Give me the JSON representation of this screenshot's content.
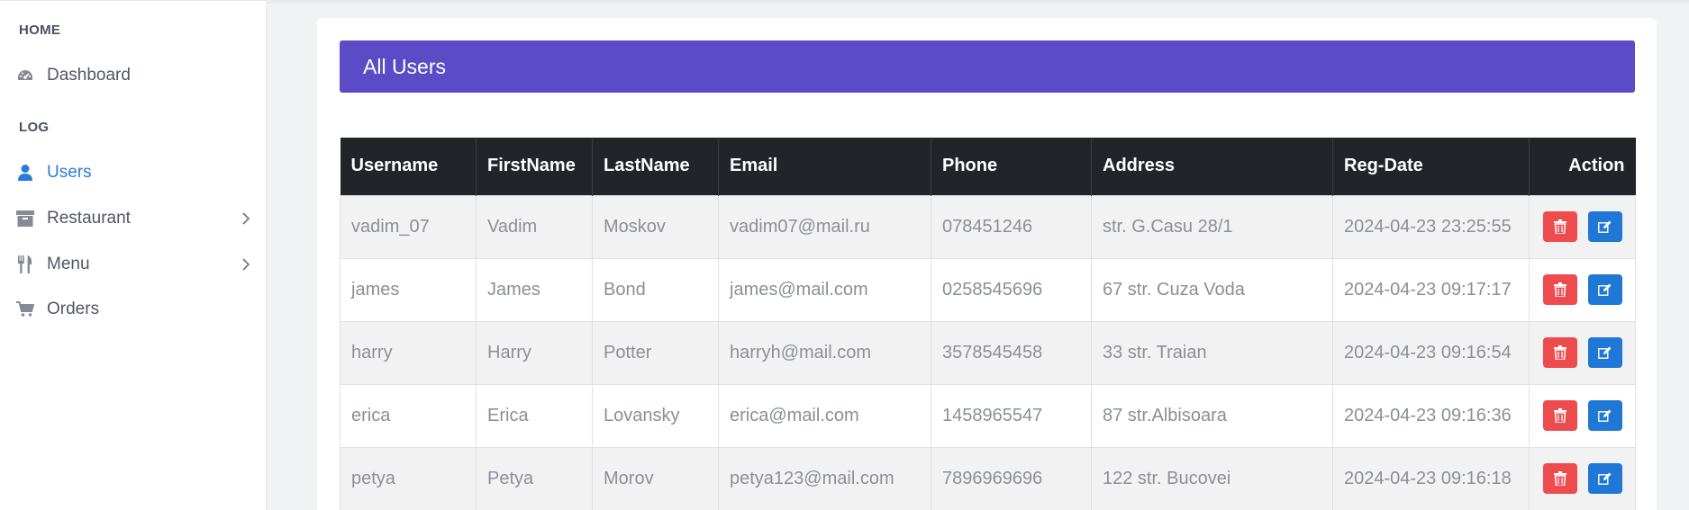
{
  "sidebar": {
    "sections": [
      {
        "header": "HOME"
      },
      {
        "header": "LOG"
      }
    ],
    "items": [
      {
        "label": "Dashboard",
        "icon": "dashboard-icon"
      },
      {
        "label": "Users",
        "icon": "user-icon",
        "active": true
      },
      {
        "label": "Restaurant",
        "icon": "archive-icon",
        "has_submenu": true
      },
      {
        "label": "Menu",
        "icon": "utensils-icon",
        "has_submenu": true
      },
      {
        "label": "Orders",
        "icon": "cart-icon"
      }
    ]
  },
  "card": {
    "title": "All Users"
  },
  "table": {
    "columns": [
      "Username",
      "FirstName",
      "LastName",
      "Email",
      "Phone",
      "Address",
      "Reg-Date",
      "Action"
    ],
    "rows": [
      {
        "username": "vadim_07",
        "firstname": "Vadim",
        "lastname": "Moskov",
        "email": "vadim07@mail.ru",
        "phone": "078451246",
        "address": "str. G.Casu 28/1",
        "reg_date": "2024-04-23 23:25:55"
      },
      {
        "username": "james",
        "firstname": "James",
        "lastname": "Bond",
        "email": "james@mail.com",
        "phone": "0258545696",
        "address": "67 str. Cuza Voda",
        "reg_date": "2024-04-23 09:17:17"
      },
      {
        "username": "harry",
        "firstname": "Harry",
        "lastname": "Potter",
        "email": "harryh@mail.com",
        "phone": "3578545458",
        "address": "33 str. Traian",
        "reg_date": "2024-04-23 09:16:54"
      },
      {
        "username": "erica",
        "firstname": "Erica",
        "lastname": "Lovansky",
        "email": "erica@mail.com",
        "phone": "1458965547",
        "address": "87 str.Albisoara",
        "reg_date": "2024-04-23 09:16:36"
      },
      {
        "username": "petya",
        "firstname": "Petya",
        "lastname": "Morov",
        "email": "petya123@mail.com",
        "phone": "7896969696",
        "address": "122 str. Bucovei",
        "reg_date": "2024-04-23 09:16:18"
      }
    ]
  },
  "colors": {
    "header_accent": "#5b4bc6",
    "table_head": "#212529",
    "delete_button": "#ee4b4f",
    "edit_button": "#1f78d6",
    "active_link": "#2b7bd9"
  }
}
